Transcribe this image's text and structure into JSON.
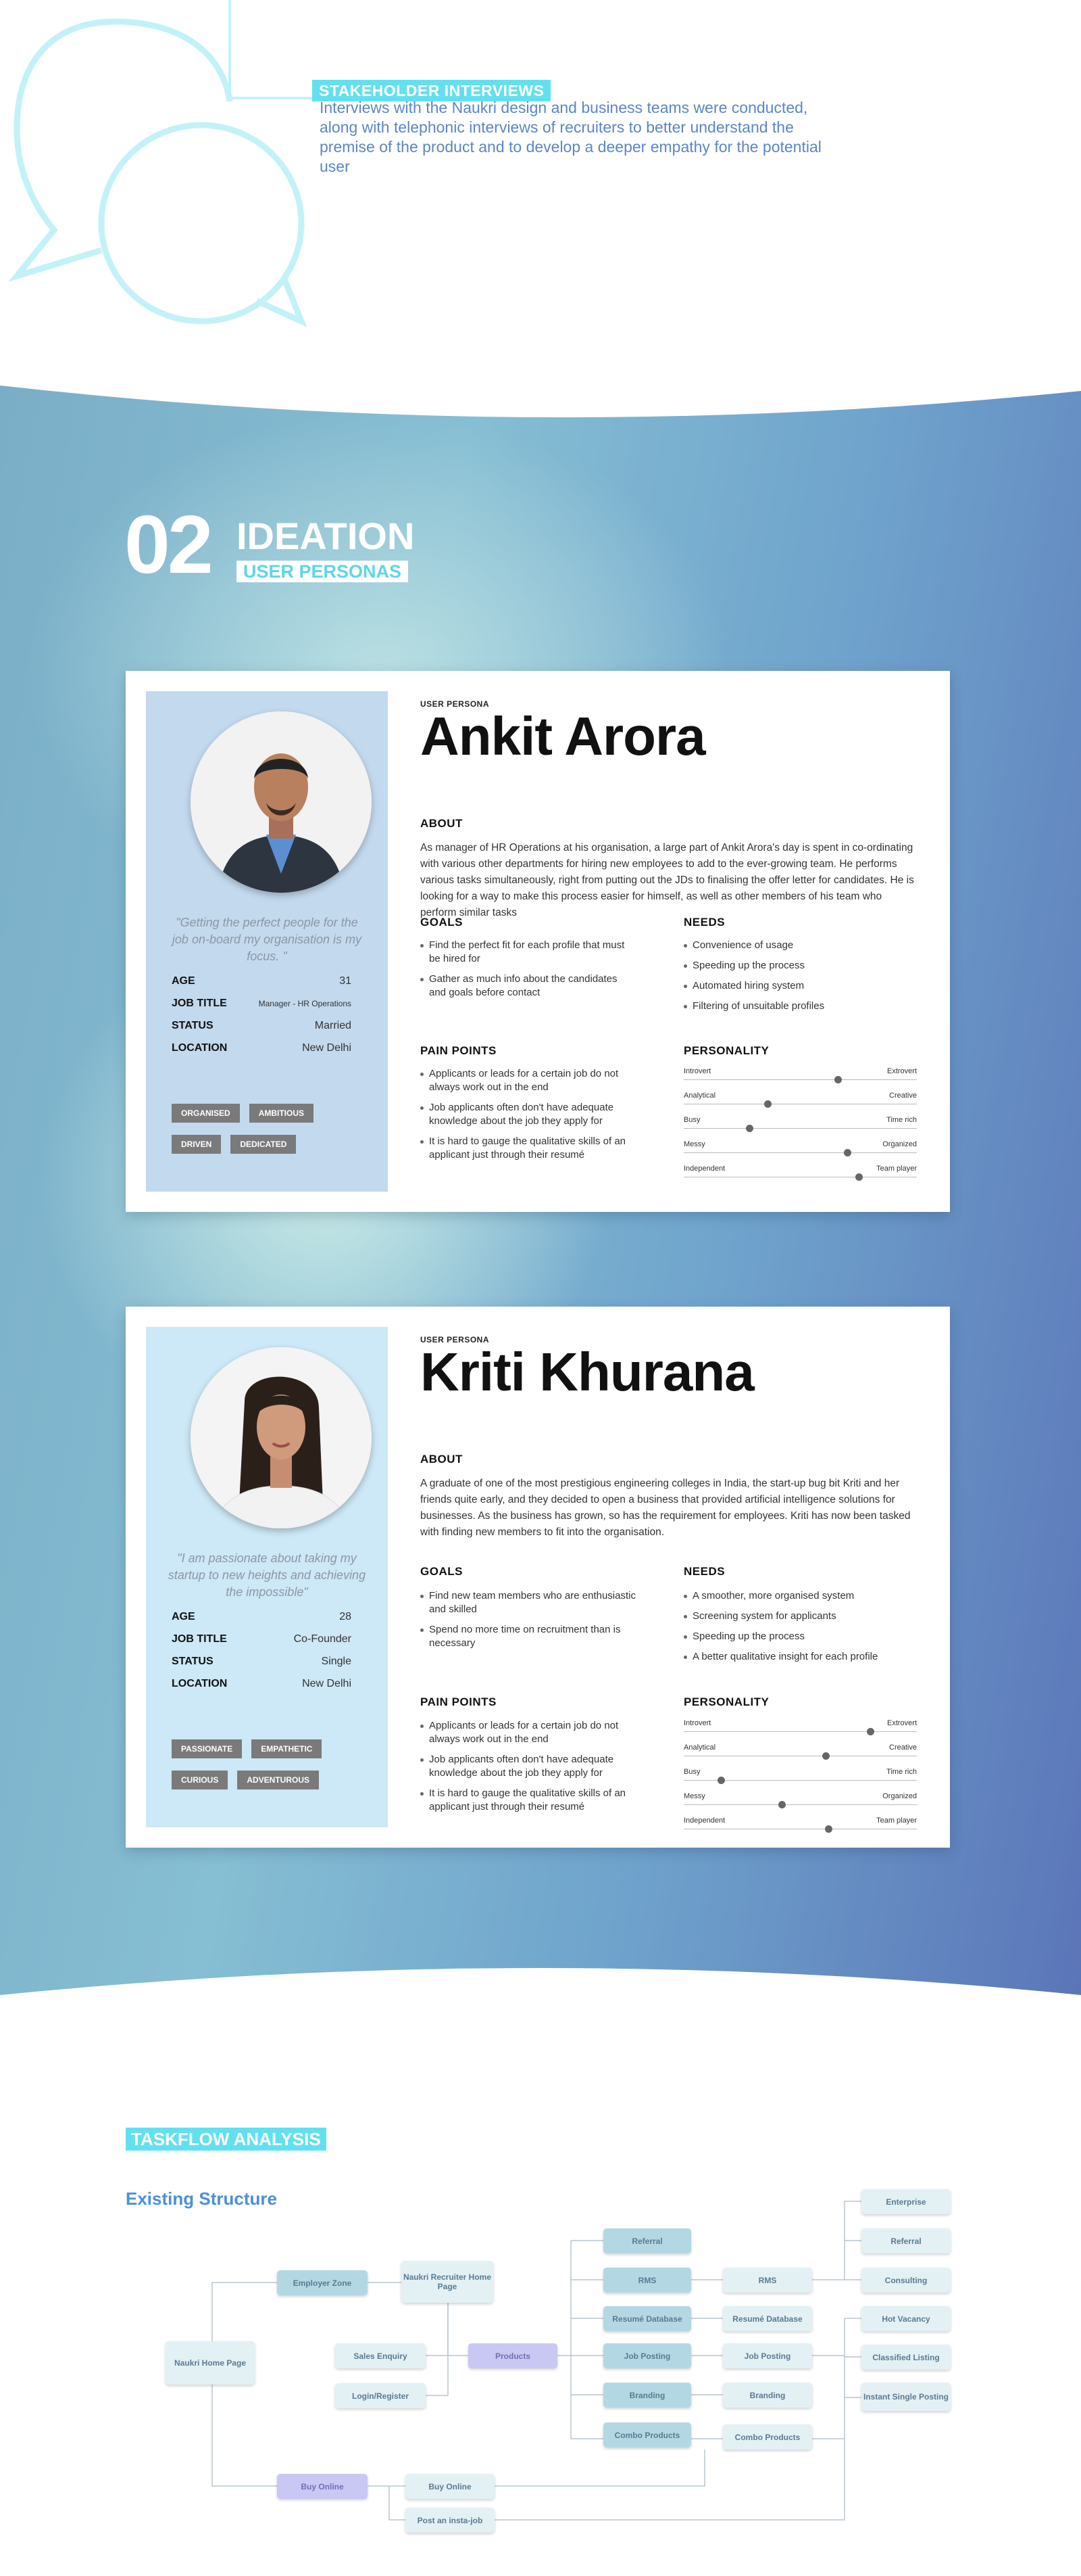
{
  "stakeholder": {
    "tag": "STAKEHOLDER INTERVIEWS",
    "text": "Interviews with the Naukri design and business teams were conducted, along with telephonic interviews of recruiters to better understand the premise of the product and to develop a deeper empathy for the potential user"
  },
  "ideation": {
    "number": "02",
    "title": "IDEATION",
    "subtitle": "USER PERSONAS"
  },
  "personas": [
    {
      "eyebrow": "USER PERSONA",
      "name": "Ankit Arora",
      "quote": "\"Getting the perfect people for the job on-board my organisation is my focus. \"",
      "facts": [
        {
          "k": "AGE",
          "v": "31"
        },
        {
          "k": "JOB TITLE",
          "v": "Manager - HR Operations"
        },
        {
          "k": "STATUS",
          "v": "Married"
        },
        {
          "k": "LOCATION",
          "v": "New Delhi"
        }
      ],
      "tags": [
        "ORGANISED",
        "AMBITIOUS",
        "DRIVEN",
        "DEDICATED"
      ],
      "about_h": "ABOUT",
      "about": "As manager of HR Operations at his organisation, a large part of Ankit Arora's day is spent in co-ordinating with various other departments for hiring new employees to add to the ever-growing team. He performs various tasks simultaneously, right from putting out the JDs to finalising the offer letter for candidates. He is looking for a way to make this process easier for himself, as well as other members of his team who perform similar tasks",
      "goals_h": "GOALS",
      "goals": [
        "Find the perfect fit for each profile that must be hired for",
        "Gather as much info about the candidates and goals before contact"
      ],
      "needs_h": "NEEDS",
      "needs": [
        "Convenience of usage",
        "Speeding up the process",
        "Automated hiring system",
        "Filtering of unsuitable profiles"
      ],
      "pain_h": "PAIN POINTS",
      "pain": [
        "Applicants or leads for a certain job do not always work out in the end",
        "Job applicants often don't have adequate knowledge about the job they apply for",
        "It is hard to gauge the qualitative skills of an applicant just through their resumé"
      ],
      "personality_h": "PERSONALITY",
      "personality": [
        {
          "l": "Introvert",
          "r": "Extrovert",
          "v": 0.66
        },
        {
          "l": "Analytical",
          "r": "Creative",
          "v": 0.36
        },
        {
          "l": "Busy",
          "r": "Time rich",
          "v": 0.28
        },
        {
          "l": "Messy",
          "r": "Organized",
          "v": 0.7
        },
        {
          "l": "Independent",
          "r": "Team player",
          "v": 0.75
        }
      ]
    },
    {
      "eyebrow": "USER PERSONA",
      "name": "Kriti Khurana",
      "quote": "\"I am passionate about taking my startup to new heights and achieving the impossible\"",
      "facts": [
        {
          "k": "AGE",
          "v": "28"
        },
        {
          "k": "JOB TITLE",
          "v": "Co-Founder"
        },
        {
          "k": "STATUS",
          "v": "Single"
        },
        {
          "k": "LOCATION",
          "v": "New Delhi"
        }
      ],
      "tags": [
        "PASSIONATE",
        "EMPATHETIC",
        "CURIOUS",
        "ADVENTUROUS"
      ],
      "about_h": "ABOUT",
      "about": "A graduate of one of the most prestigious engineering colleges in India, the start-up bug bit Kriti and her friends quite early, and they decided to open a business that provided artificial intelligence solutions for businesses. As the business has grown, so has the requirement for employees. Kriti has now been tasked with finding new members to fit into the organisation.",
      "goals_h": "GOALS",
      "goals": [
        "Find new team members who are enthusiastic and skilled",
        "Spend no more time on recruitment than is necessary"
      ],
      "needs_h": "NEEDS",
      "needs": [
        "A smoother, more organised system",
        "Screening system for applicants",
        "Speeding up the process",
        "A better qualitative insight for each profile"
      ],
      "pain_h": "PAIN POINTS",
      "pain": [
        "Applicants or leads for a certain job do not always work out in the end",
        "Job applicants often don't have adequate knowledge about the job they apply for",
        "It is hard to gauge the qualitative skills of an applicant just through their resumé"
      ],
      "personality_h": "PERSONALITY",
      "personality": [
        {
          "l": "Introvert",
          "r": "Extrovert",
          "v": 0.8
        },
        {
          "l": "Analytical",
          "r": "Creative",
          "v": 0.61
        },
        {
          "l": "Busy",
          "r": "Time rich",
          "v": 0.16
        },
        {
          "l": "Messy",
          "r": "Organized",
          "v": 0.42
        },
        {
          "l": "Independent",
          "r": "Team player",
          "v": 0.62
        }
      ]
    }
  ],
  "taskflow": {
    "tag": "TASKFLOW ANALYSIS",
    "heading": "Existing Structure",
    "nodes": {
      "naukri_home": "Naukri Home Page",
      "employer_zone": "Employer Zone",
      "recruiter_home": "Naukri Recruiter Home Page",
      "sales_enquiry": "Sales Enquiry",
      "login_register": "Login/Register",
      "products": "Products",
      "buy_online_a": "Buy Online",
      "buy_online_b": "Buy Online",
      "insta_job": "Post an insta-job",
      "referral_a": "Referral",
      "rms_a": "RMS",
      "rms_b": "RMS",
      "resume_db_a": "Resumé Database",
      "resume_db_b": "Resumé Database",
      "job_posting_a": "Job Posting",
      "job_posting_b": "Job Posting",
      "branding_a": "Branding",
      "branding_b": "Branding",
      "combo_a": "Combo Products",
      "combo_b": "Combo Products",
      "enterprise": "Enterprise",
      "referral_b": "Referral",
      "consulting": "Consulting",
      "hot_vacancy": "Hot Vacancy",
      "classified": "Classified Listing",
      "instant_single": "Instant Single Posting"
    }
  },
  "colors": {
    "cyan_tag": "#63e0ef",
    "blue_text": "#5b86c6",
    "link_blue": "#4a90d9",
    "card_side_1": "#c3d9ee",
    "card_side_2": "#cde8f6",
    "tag_grey": "#7a7a7a"
  }
}
